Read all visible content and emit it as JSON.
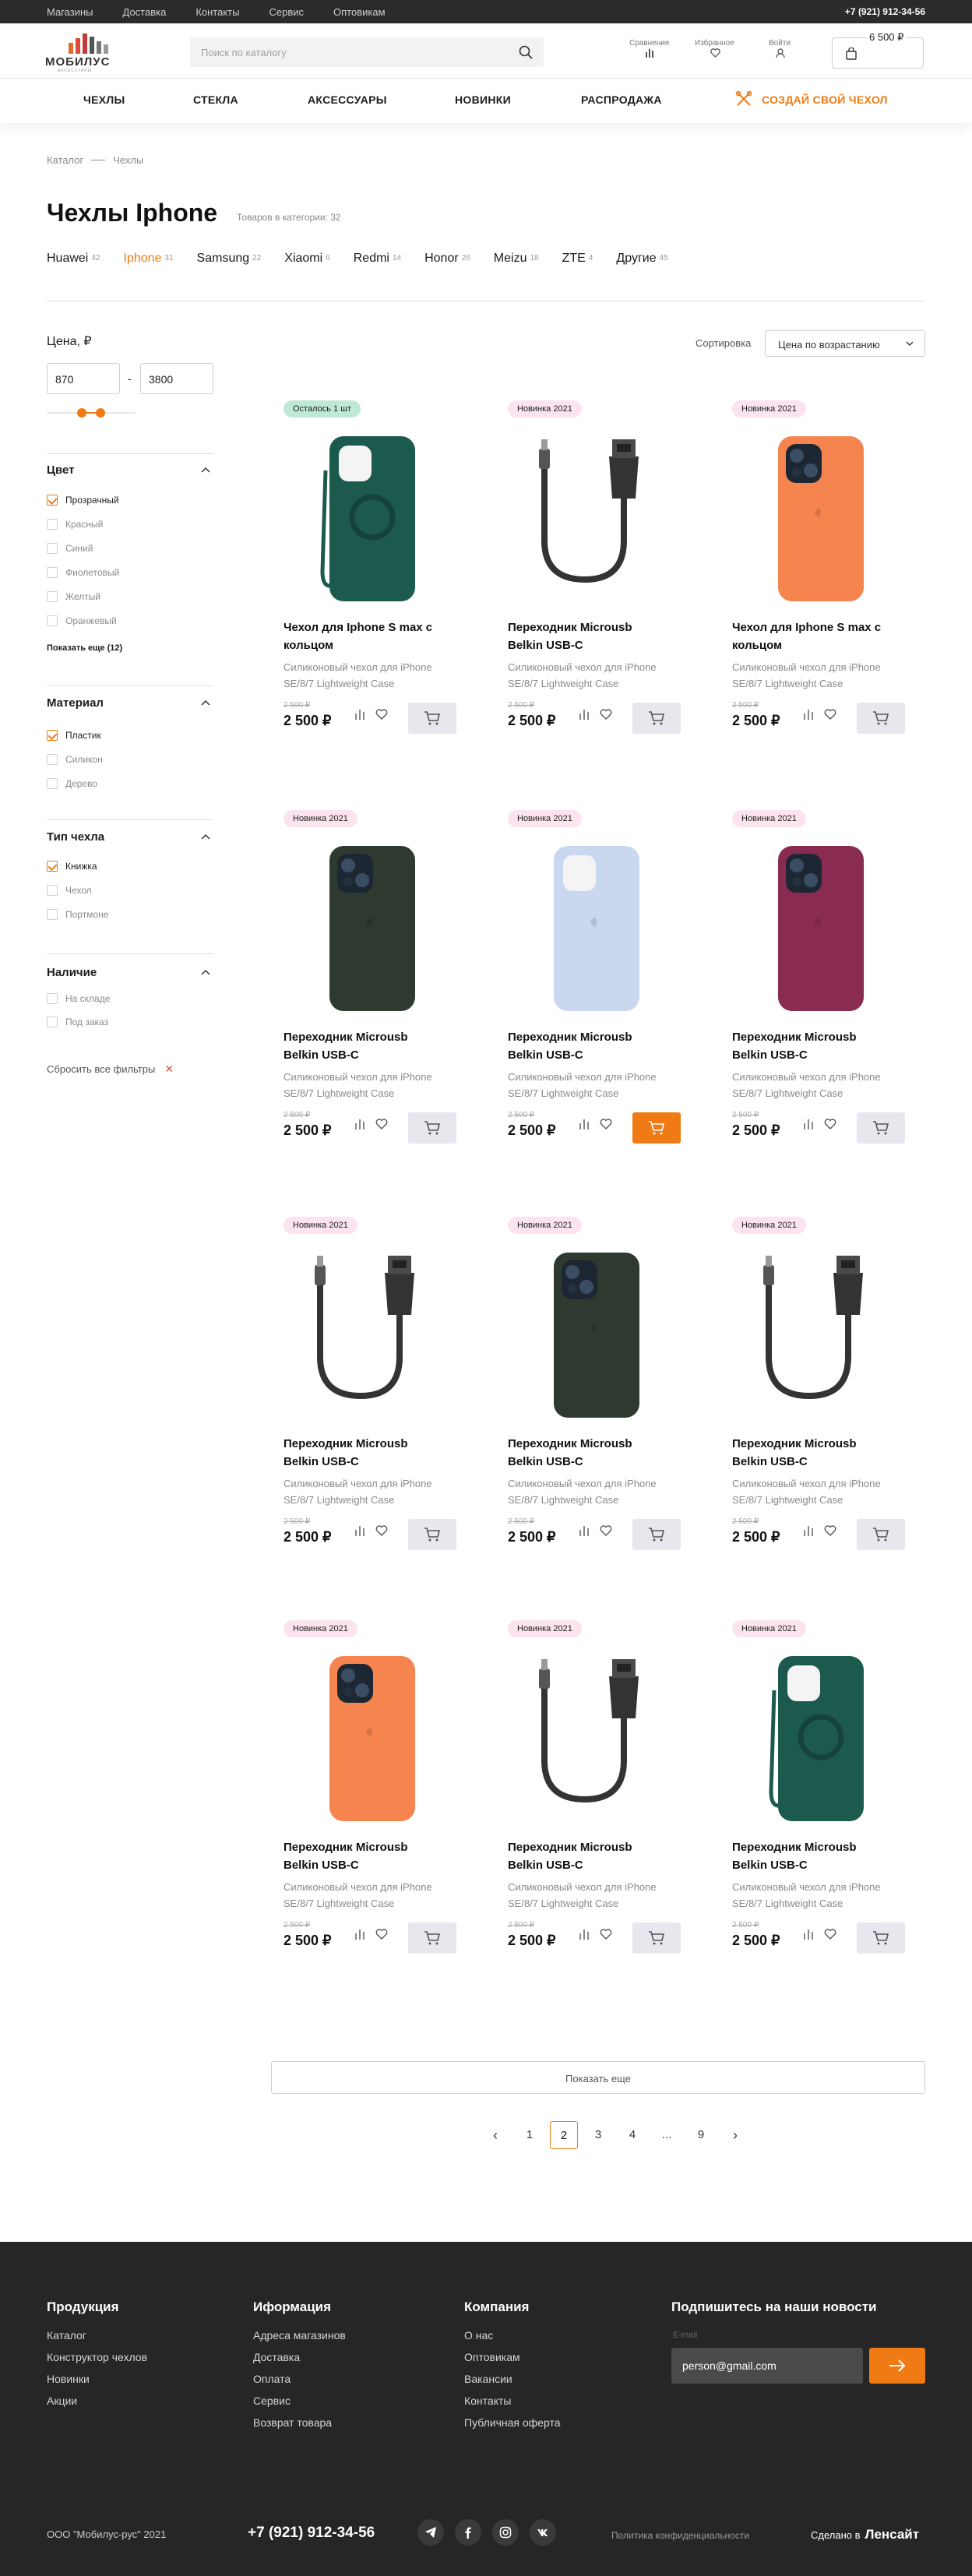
{
  "topbar": {
    "links": [
      "Магазины",
      "Доставка",
      "Контакты",
      "Сервис",
      "Оптовикам"
    ],
    "phone": "+7 (921) 912-34-56"
  },
  "header": {
    "logo": "МОБИЛУС",
    "logo_sub": "АКСЕССУАРЫ",
    "search_placeholder": "Поиск по каталогу",
    "compare": "Сравнение",
    "favorites": "Избранное",
    "login": "Войти",
    "cart_price": "6 500 ₽"
  },
  "nav": {
    "items": [
      "ЧЕХЛЫ",
      "СТЕКЛА",
      "АКСЕССУАРЫ",
      "НОВИНКИ",
      "РАСПРОДАЖА"
    ],
    "custom": "СОЗДАЙ СВОЙ ЧЕХОЛ"
  },
  "breadcrumbs": [
    "Каталог",
    "Чехлы"
  ],
  "page": {
    "title": "Чехлы Iphone",
    "count": "Товаров в категории: 32"
  },
  "brands": [
    {
      "name": "Huawei",
      "count": "42"
    },
    {
      "name": "Iphone",
      "count": "31"
    },
    {
      "name": "Samsung",
      "count": "22"
    },
    {
      "name": "Xiaomi",
      "count": "6"
    },
    {
      "name": "Redmi",
      "count": "14"
    },
    {
      "name": "Honor",
      "count": "26"
    },
    {
      "name": "Meizu",
      "count": "18"
    },
    {
      "name": "ZTE",
      "count": "4"
    },
    {
      "name": "Другие",
      "count": "45"
    }
  ],
  "filters": {
    "price_title": "Цена, ₽",
    "price_from": "870",
    "price_to": "3800",
    "color_title": "Цвет",
    "colors": [
      "Прозрачный",
      "Красный",
      "Синий",
      "Фиолетовый",
      "Желтый",
      "Оранжевый"
    ],
    "show_more": "Показать еще (12)",
    "material_title": "Материал",
    "materials": [
      "Пластик",
      "Силикон",
      "Дерево"
    ],
    "type_title": "Тип чехла",
    "types": [
      "Книжка",
      "Чехол",
      "Портмоне"
    ],
    "stock_title": "Наличие",
    "stock": [
      "На складе",
      "Под заказ"
    ],
    "reset": "Сбросить все фильтры"
  },
  "sort": {
    "label": "Сортировка",
    "value": "Цена по возрастанию"
  },
  "products": [
    {
      "badge": "Осталось 1 шт",
      "name": "Чехол для Iphone S max с кольцом",
      "desc": "Силиконовый чехол для iPhone SE/8/7 Lightweight Case",
      "old": "2 500 ₽",
      "price": "2 500 ₽"
    },
    {
      "badge": "Новинка 2021",
      "name": "Переходник Microusb Belkin USB-C",
      "desc": "Силиконовый чехол для iPhone SE/8/7 Lightweight Case",
      "old": "2 500 ₽",
      "price": "2 500 ₽"
    },
    {
      "badge": "Новинка 2021",
      "name": "Чехол для Iphone S max с кольцом",
      "desc": "Силиконовый чехол для iPhone SE/8/7 Lightweight Case",
      "old": "2 500 ₽",
      "price": "2 500 ₽"
    },
    {
      "badge": "Новинка 2021",
      "name": "Переходник Microusb Belkin USB-C",
      "desc": "Силиконовый чехол для iPhone SE/8/7 Lightweight Case",
      "old": "2 500 ₽",
      "price": "2 500 ₽"
    },
    {
      "badge": "Новинка 2021",
      "name": "Переходник Microusb Belkin USB-C",
      "desc": "Силиконовый чехол для iPhone SE/8/7 Lightweight Case",
      "old": "2 500 ₽",
      "price": "2 500 ₽"
    },
    {
      "badge": "Новинка 2021",
      "name": "Переходник Microusb Belkin USB-C",
      "desc": "Силиконовый чехол для iPhone SE/8/7 Lightweight Case",
      "old": "2 500 ₽",
      "price": "2 500 ₽"
    },
    {
      "badge": "Новинка 2021",
      "name": "Переходник Microusb Belkin USB-C",
      "desc": "Силиконовый чехол для iPhone SE/8/7 Lightweight Case",
      "old": "2 500 ₽",
      "price": "2 500 ₽"
    },
    {
      "badge": "Новинка 2021",
      "name": "Переходник Microusb Belkin USB-C",
      "desc": "Силиконовый чехол для iPhone SE/8/7 Lightweight Case",
      "old": "2 500 ₽",
      "price": "2 500 ₽"
    },
    {
      "badge": "Новинка 2021",
      "name": "Переходник Microusb Belkin USB-C",
      "desc": "Силиконовый чехол для iPhone SE/8/7 Lightweight Case",
      "old": "2 500 ₽",
      "price": "2 500 ₽"
    },
    {
      "badge": "Новинка 2021",
      "name": "Переходник Microusb Belkin USB-C",
      "desc": "Силиконовый чехол для iPhone SE/8/7 Lightweight Case",
      "old": "2 500 ₽",
      "price": "2 500 ₽"
    },
    {
      "badge": "Новинка 2021",
      "name": "Переходник Microusb Belkin USB-C",
      "desc": "Силиконовый чехол для iPhone SE/8/7 Lightweight Case",
      "old": "2 500 ₽",
      "price": "2 500 ₽"
    },
    {
      "badge": "Новинка 2021",
      "name": "Переходник Microusb Belkin USB-C",
      "desc": "Силиконовый чехол для iPhone SE/8/7 Lightweight Case",
      "old": "2 500 ₽",
      "price": "2 500 ₽"
    }
  ],
  "show_more": "Показать еще",
  "pagination": [
    "1",
    "2",
    "3",
    "4",
    "...",
    "9"
  ],
  "footer": {
    "col1_title": "Продукция",
    "col1": [
      "Каталог",
      "Конструктор чехлов",
      "Новинки",
      "Акции"
    ],
    "col2_title": "Иформация",
    "col2": [
      "Адреса магазинов",
      "Доставка",
      "Оплата",
      "Сервис",
      "Возврат товара"
    ],
    "col3_title": "Компания",
    "col3": [
      "О нас",
      "Оптовикам",
      "Вакансии",
      "Контакты",
      "Публичная оферта"
    ],
    "subscribe_title": "Подпишитесь на наши новости",
    "email_label": "E-mail",
    "email_value": "person@gmail.com",
    "copyright": "ООО \"Мобилус-рус\" 2021",
    "phone": "+7 (921) 912-34-56",
    "policy": "Политика конфиденциальности",
    "made_by": "Сделано в",
    "made_by_brand": "Ленсайт"
  },
  "colors": {
    "accent": "#f07b14",
    "dark": "#262626"
  }
}
